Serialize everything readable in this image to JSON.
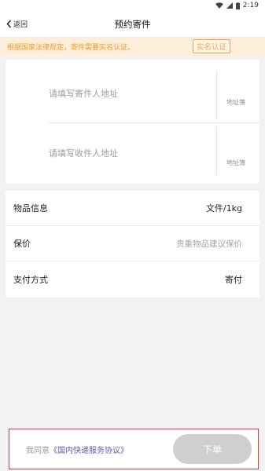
{
  "status_bar": {
    "time": "2:19"
  },
  "header": {
    "back_label": "返回",
    "title": "预约寄件"
  },
  "notice": {
    "text": "根据国家法律规定，寄件需要实名认证。",
    "button_label": "实名认证"
  },
  "address": {
    "sender_placeholder": "请填写寄件人地址",
    "receiver_placeholder": "请填写收件人地址",
    "address_book_label": "地址簿"
  },
  "info": {
    "rows": [
      {
        "label": "物品信息",
        "value": "文件/1kg"
      },
      {
        "label": "保价",
        "value": "贵重物品建议保价"
      },
      {
        "label": "支付方式",
        "value": "寄付"
      }
    ]
  },
  "footer": {
    "agree_prefix": "我同意",
    "agreement_link": "《国内快递服务协议》",
    "order_button": "下单"
  }
}
